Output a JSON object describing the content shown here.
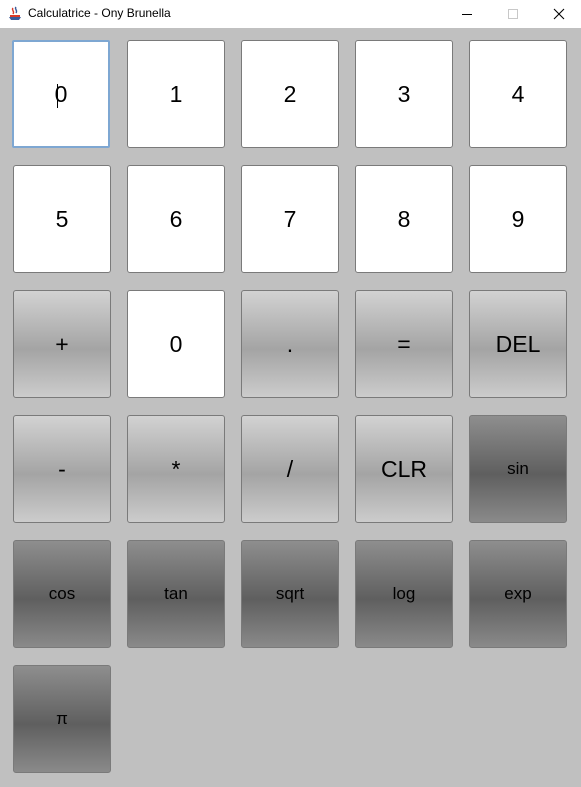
{
  "window": {
    "title": "Calculatrice - Ony Brunella"
  },
  "keypad": {
    "rows": [
      [
        "0",
        "1",
        "2",
        "3",
        "4"
      ],
      [
        "5",
        "6",
        "7",
        "8",
        "9"
      ],
      [
        "+",
        "0",
        ".",
        "=",
        "DEL"
      ],
      [
        "-",
        "*",
        "/",
        "CLR",
        "sin"
      ],
      [
        "cos",
        "tan",
        "sqrt",
        "log",
        "exp"
      ],
      [
        "π"
      ]
    ]
  },
  "colors": {
    "background": "#c0c0c0",
    "key_white": "#ffffff",
    "key_light": "#b4b4b4",
    "key_dark": "#6e6e6e",
    "focus_border": "#7ea7d2"
  },
  "icons": {
    "app": "java-coffee-icon",
    "minimize": "minimize-icon",
    "maximize": "maximize-icon",
    "close": "close-icon"
  }
}
